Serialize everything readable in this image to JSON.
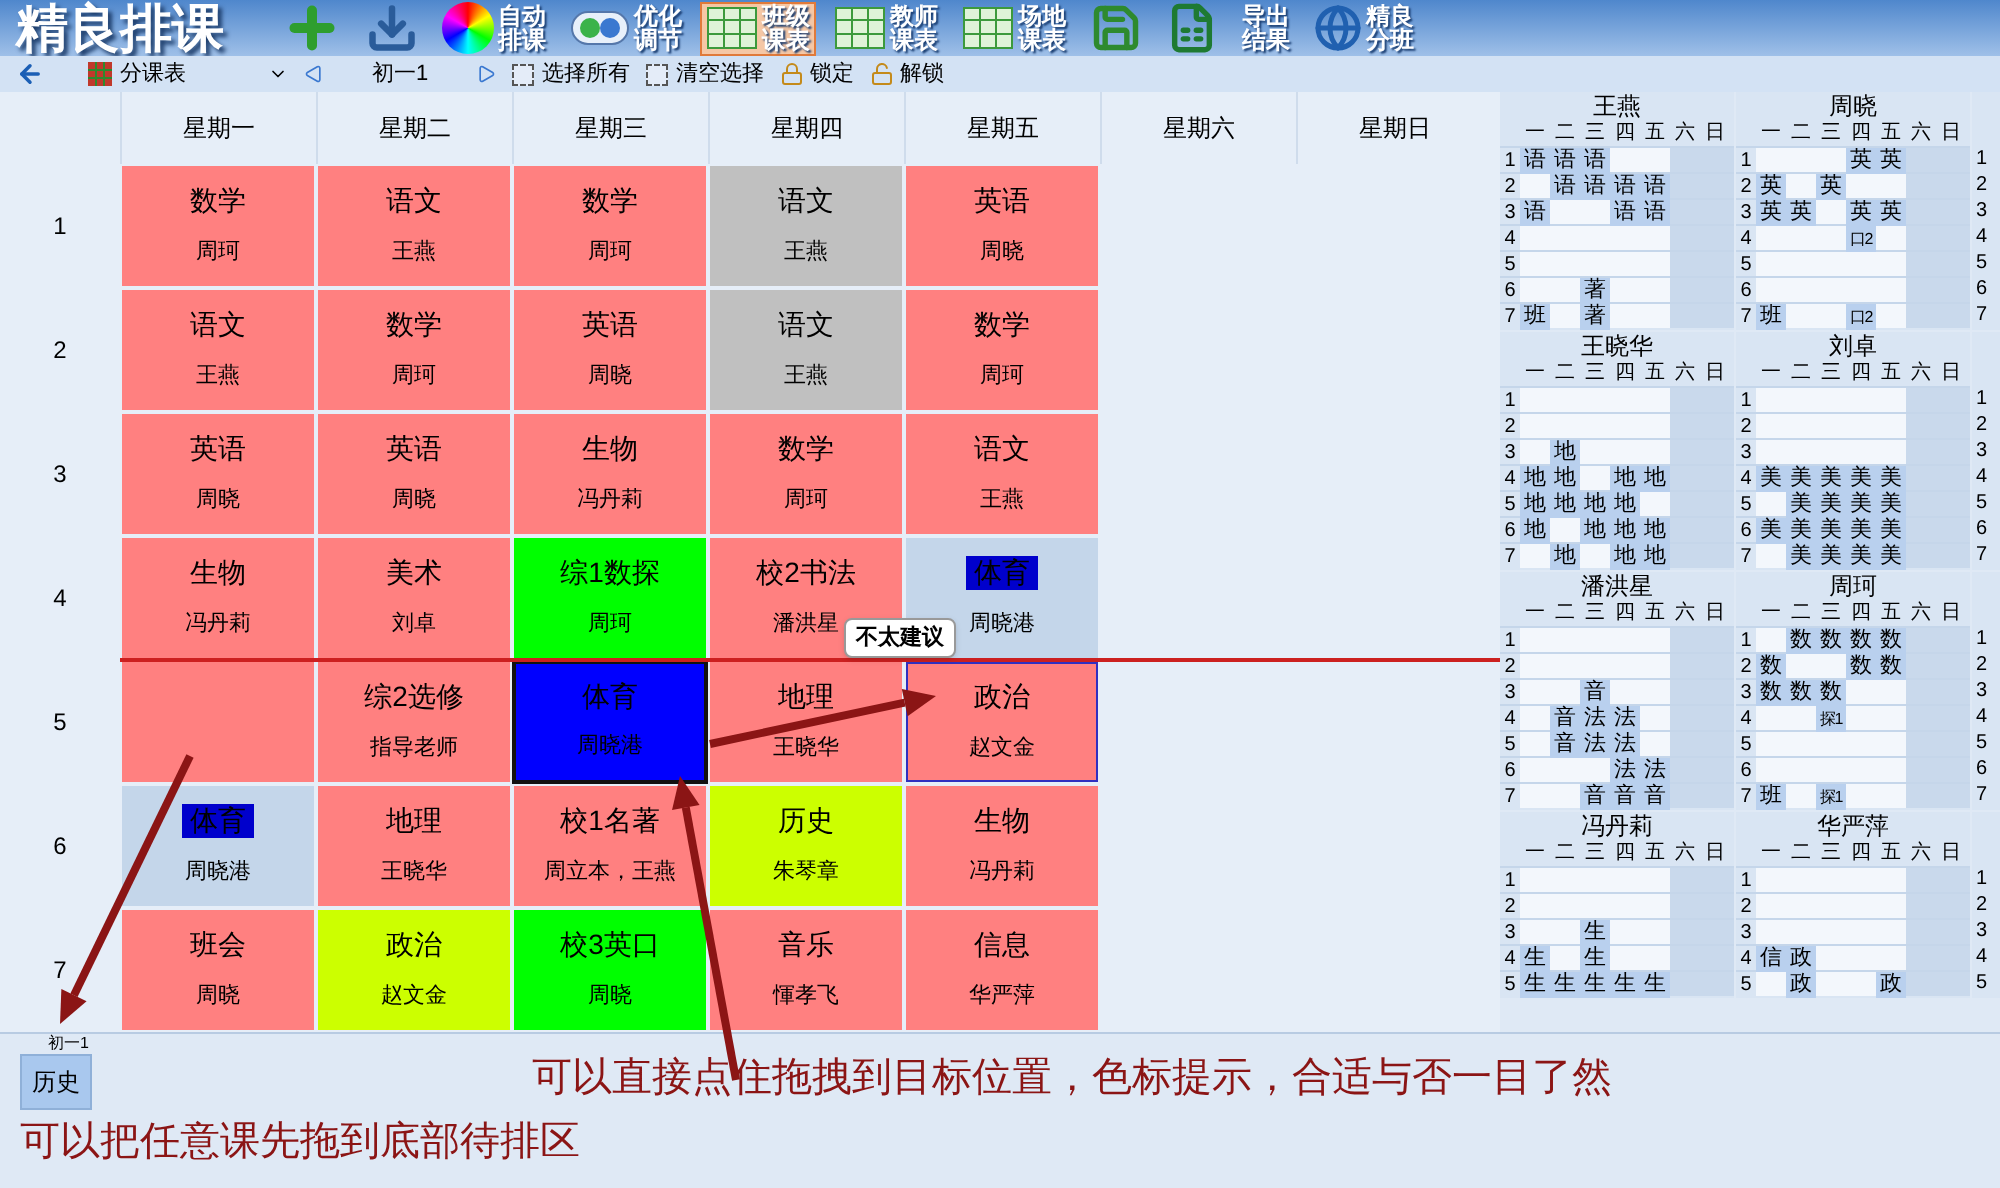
{
  "app_title": "精良排课",
  "toolbar": [
    {
      "kind": "add",
      "selected": false
    },
    {
      "kind": "import",
      "selected": false
    },
    {
      "kind": "auto",
      "lines": [
        "自动",
        "排课"
      ],
      "selected": false
    },
    {
      "kind": "optimize",
      "lines": [
        "优化",
        "调节"
      ],
      "selected": false
    },
    {
      "kind": "grid",
      "lines": [
        "班级",
        "课表"
      ],
      "selected": true
    },
    {
      "kind": "grid",
      "lines": [
        "教师",
        "课表"
      ],
      "selected": false
    },
    {
      "kind": "grid",
      "lines": [
        "场地",
        "课表"
      ],
      "selected": false
    },
    {
      "kind": "save",
      "selected": false
    },
    {
      "kind": "excel",
      "selected": false
    },
    {
      "kind": "text",
      "lines": [
        "导出",
        "结果"
      ],
      "selected": false
    },
    {
      "kind": "globe",
      "lines": [
        "精良",
        "分班"
      ],
      "selected": false
    }
  ],
  "nav": {
    "view": "分课表",
    "class_name": "初一1",
    "select_all": {
      "label": "选择所有",
      "checked": false
    },
    "clear_selection": {
      "label": "清空选择",
      "checked": false
    },
    "lock": "锁定",
    "unlock": "解锁"
  },
  "grid": {
    "columns": [
      "星期一",
      "星期二",
      "星期三",
      "星期四",
      "星期五",
      "星期六",
      "星期日"
    ],
    "rows": [
      {
        "period": "1",
        "cells": [
          {
            "subject": "数学",
            "teacher": "周珂",
            "color": "#ff8080",
            "selected": false,
            "drop_target": false,
            "highlighted": false
          },
          {
            "subject": "语文",
            "teacher": "王燕",
            "color": "#ff8080",
            "selected": false,
            "drop_target": false,
            "highlighted": false
          },
          {
            "subject": "数学",
            "teacher": "周珂",
            "color": "#ff8080",
            "selected": false,
            "drop_target": false,
            "highlighted": false
          },
          {
            "subject": "语文",
            "teacher": "王燕",
            "color": "#c0c0c0",
            "selected": false,
            "drop_target": false,
            "highlighted": false
          },
          {
            "subject": "英语",
            "teacher": "周晓",
            "color": "#ff8080",
            "selected": false,
            "drop_target": false,
            "highlighted": false
          }
        ]
      },
      {
        "period": "2",
        "cells": [
          {
            "subject": "语文",
            "teacher": "王燕",
            "color": "#ff8080",
            "selected": false,
            "drop_target": false,
            "highlighted": false
          },
          {
            "subject": "数学",
            "teacher": "周珂",
            "color": "#ff8080",
            "selected": false,
            "drop_target": false,
            "highlighted": false
          },
          {
            "subject": "英语",
            "teacher": "周晓",
            "color": "#ff8080",
            "selected": false,
            "drop_target": false,
            "highlighted": false
          },
          {
            "subject": "语文",
            "teacher": "王燕",
            "color": "#c0c0c0",
            "selected": false,
            "drop_target": false,
            "highlighted": false
          },
          {
            "subject": "数学",
            "teacher": "周珂",
            "color": "#ff8080",
            "selected": false,
            "drop_target": false,
            "highlighted": false
          }
        ]
      },
      {
        "period": "3",
        "cells": [
          {
            "subject": "英语",
            "teacher": "周晓",
            "color": "#ff8080",
            "selected": false,
            "drop_target": false,
            "highlighted": false
          },
          {
            "subject": "英语",
            "teacher": "周晓",
            "color": "#ff8080",
            "selected": false,
            "drop_target": false,
            "highlighted": false
          },
          {
            "subject": "生物",
            "teacher": "冯丹莉",
            "color": "#ff8080",
            "selected": false,
            "drop_target": false,
            "highlighted": false
          },
          {
            "subject": "数学",
            "teacher": "周珂",
            "color": "#ff8080",
            "selected": false,
            "drop_target": false,
            "highlighted": false
          },
          {
            "subject": "语文",
            "teacher": "王燕",
            "color": "#ff8080",
            "selected": false,
            "drop_target": false,
            "highlighted": false
          }
        ]
      },
      {
        "period": "4",
        "cells": [
          {
            "subject": "生物",
            "teacher": "冯丹莉",
            "color": "#ff8080",
            "selected": false,
            "drop_target": false,
            "highlighted": false
          },
          {
            "subject": "美术",
            "teacher": "刘卓",
            "color": "#ff8080",
            "selected": false,
            "drop_target": false,
            "highlighted": false
          },
          {
            "subject": "综1数探",
            "teacher": "周珂",
            "color": "#00ff00",
            "selected": false,
            "drop_target": false,
            "highlighted": false
          },
          {
            "subject": "校2书法",
            "teacher": "潘洪星",
            "color": "#ff8080",
            "selected": false,
            "drop_target": false,
            "highlighted": false
          },
          {
            "subject": "体育",
            "teacher": "周晓港",
            "color": "#c4d6ea",
            "selected": false,
            "drop_target": false,
            "highlighted": true
          }
        ]
      },
      {
        "period": "5",
        "cells": [
          {
            "color": "#ff8080",
            "selected": false,
            "drop_target": false
          },
          {
            "subject": "综2选修",
            "teacher": "指导老师",
            "color": "#ff8080",
            "selected": false,
            "drop_target": false,
            "highlighted": false
          },
          {
            "subject": "体育",
            "teacher": "周晓港",
            "color": "#0000ff",
            "selected": true,
            "drop_target": false,
            "highlighted": false
          },
          {
            "subject": "地理",
            "teacher": "王晓华",
            "color": "#ff8080",
            "selected": false,
            "drop_target": false,
            "highlighted": false
          },
          {
            "subject": "政治",
            "teacher": "赵文金",
            "color": "#ff8080",
            "selected": false,
            "drop_target": true,
            "highlighted": false
          }
        ]
      },
      {
        "period": "6",
        "cells": [
          {
            "subject": "体育",
            "teacher": "周晓港",
            "color": "#c4d6ea",
            "selected": false,
            "drop_target": false,
            "highlighted": true
          },
          {
            "subject": "地理",
            "teacher": "王晓华",
            "color": "#ff8080",
            "selected": false,
            "drop_target": false,
            "highlighted": false
          },
          {
            "subject": "校1名著",
            "teacher": "周立本，王燕",
            "color": "#ff8080",
            "selected": false,
            "drop_target": false,
            "highlighted": false
          },
          {
            "subject": "历史",
            "teacher": "朱琴章",
            "color": "#ccff00",
            "selected": false,
            "drop_target": false,
            "highlighted": false
          },
          {
            "subject": "生物",
            "teacher": "冯丹莉",
            "color": "#ff8080",
            "selected": false,
            "drop_target": false,
            "highlighted": false
          }
        ]
      },
      {
        "period": "7",
        "cells": [
          {
            "subject": "班会",
            "teacher": "周晓",
            "color": "#ff8080",
            "selected": false,
            "drop_target": false,
            "highlighted": false
          },
          {
            "subject": "政治",
            "teacher": "赵文金",
            "color": "#ccff00",
            "selected": false,
            "drop_target": false,
            "highlighted": false
          },
          {
            "subject": "校3英口",
            "teacher": "周晓",
            "color": "#00ff00",
            "selected": false,
            "drop_target": false,
            "highlighted": false
          },
          {
            "subject": "音乐",
            "teacher": "惲孝飞",
            "color": "#ff8080",
            "selected": false,
            "drop_target": false,
            "highlighted": false
          },
          {
            "subject": "信息",
            "teacher": "华严萍",
            "color": "#ff8080",
            "selected": false,
            "drop_target": false,
            "highlighted": false
          }
        ]
      }
    ],
    "tooltip": "不太建议"
  },
  "teacher_tables": [
    {
      "name": "王燕",
      "columns": [
        "一",
        "二",
        "三",
        "四",
        "五",
        "六",
        "日"
      ],
      "rows": [
        {
          "label": "1",
          "cells": [
            "语",
            "语",
            "语",
            null,
            null,
            null,
            null
          ]
        },
        {
          "label": "2",
          "cells": [
            null,
            "语",
            "语",
            "语",
            "语",
            null,
            null
          ]
        },
        {
          "label": "3",
          "cells": [
            "语",
            null,
            null,
            "语",
            "语",
            null,
            null
          ]
        },
        {
          "label": "4",
          "cells": [
            null,
            null,
            null,
            null,
            null,
            null,
            null
          ]
        },
        {
          "label": "5",
          "cells": [
            null,
            null,
            null,
            null,
            null,
            null,
            null
          ]
        },
        {
          "label": "6",
          "cells": [
            null,
            null,
            "著",
            null,
            null,
            null,
            null
          ]
        },
        {
          "label": "7",
          "cells": [
            "班",
            null,
            "著",
            null,
            null,
            null,
            null
          ]
        }
      ]
    },
    {
      "name": "周晓",
      "columns": [
        "一",
        "二",
        "三",
        "四",
        "五",
        "六",
        "日"
      ],
      "rows": [
        {
          "label": "1",
          "cells": [
            null,
            null,
            null,
            "英",
            "英",
            null,
            null
          ]
        },
        {
          "label": "2",
          "cells": [
            "英",
            null,
            "英",
            null,
            null,
            null,
            null
          ]
        },
        {
          "label": "3",
          "cells": [
            "英",
            "英",
            null,
            "英",
            "英",
            null,
            null
          ]
        },
        {
          "label": "4",
          "cells": [
            null,
            null,
            null,
            "口2",
            null,
            null,
            null
          ]
        },
        {
          "label": "5",
          "cells": [
            null,
            null,
            null,
            null,
            null,
            null,
            null
          ]
        },
        {
          "label": "6",
          "cells": [
            null,
            null,
            null,
            null,
            null,
            null,
            null
          ]
        },
        {
          "label": "7",
          "cells": [
            "班",
            null,
            null,
            "口2",
            null,
            null,
            null
          ]
        }
      ]
    },
    {
      "name": "王晓华",
      "columns": [
        "一",
        "二",
        "三",
        "四",
        "五",
        "六",
        "日"
      ],
      "rows": [
        {
          "label": "1",
          "cells": [
            null,
            null,
            null,
            null,
            null,
            null,
            null
          ]
        },
        {
          "label": "2",
          "cells": [
            null,
            null,
            null,
            null,
            null,
            null,
            null
          ]
        },
        {
          "label": "3",
          "cells": [
            null,
            "地",
            null,
            null,
            null,
            null,
            null
          ]
        },
        {
          "label": "4",
          "cells": [
            "地",
            "地",
            null,
            "地",
            "地",
            null,
            null
          ]
        },
        {
          "label": "5",
          "cells": [
            "地",
            "地",
            "地",
            "地",
            null,
            null,
            null
          ]
        },
        {
          "label": "6",
          "cells": [
            "地",
            null,
            "地",
            "地",
            "地",
            null,
            null
          ]
        },
        {
          "label": "7",
          "cells": [
            null,
            "地",
            null,
            "地",
            "地",
            null,
            null
          ]
        }
      ]
    },
    {
      "name": "刘卓",
      "columns": [
        "一",
        "二",
        "三",
        "四",
        "五",
        "六",
        "日"
      ],
      "rows": [
        {
          "label": "1",
          "cells": [
            null,
            null,
            null,
            null,
            null,
            null,
            null
          ]
        },
        {
          "label": "2",
          "cells": [
            null,
            null,
            null,
            null,
            null,
            null,
            null
          ]
        },
        {
          "label": "3",
          "cells": [
            null,
            null,
            null,
            null,
            null,
            null,
            null
          ]
        },
        {
          "label": "4",
          "cells": [
            "美",
            "美",
            "美",
            "美",
            "美",
            null,
            null
          ]
        },
        {
          "label": "5",
          "cells": [
            null,
            "美",
            "美",
            "美",
            "美",
            null,
            null
          ]
        },
        {
          "label": "6",
          "cells": [
            "美",
            "美",
            "美",
            "美",
            "美",
            null,
            null
          ]
        },
        {
          "label": "7",
          "cells": [
            null,
            "美",
            "美",
            "美",
            "美",
            null,
            null
          ]
        }
      ]
    },
    {
      "name": "潘洪星",
      "columns": [
        "一",
        "二",
        "三",
        "四",
        "五",
        "六",
        "日"
      ],
      "rows": [
        {
          "label": "1",
          "cells": [
            null,
            null,
            null,
            null,
            null,
            null,
            null
          ]
        },
        {
          "label": "2",
          "cells": [
            null,
            null,
            null,
            null,
            null,
            null,
            null
          ]
        },
        {
          "label": "3",
          "cells": [
            null,
            null,
            "音",
            null,
            null,
            null,
            null
          ]
        },
        {
          "label": "4",
          "cells": [
            null,
            "音",
            "法",
            "法",
            null,
            null,
            null
          ]
        },
        {
          "label": "5",
          "cells": [
            null,
            "音",
            "法",
            "法",
            null,
            null,
            null
          ]
        },
        {
          "label": "6",
          "cells": [
            null,
            null,
            null,
            "法",
            "法",
            null,
            null
          ]
        },
        {
          "label": "7",
          "cells": [
            null,
            null,
            "音",
            "音",
            "音",
            null,
            null
          ]
        }
      ]
    },
    {
      "name": "周珂",
      "columns": [
        "一",
        "二",
        "三",
        "四",
        "五",
        "六",
        "日"
      ],
      "rows": [
        {
          "label": "1",
          "cells": [
            null,
            "数",
            "数",
            "数",
            "数",
            null,
            null
          ]
        },
        {
          "label": "2",
          "cells": [
            "数",
            null,
            null,
            "数",
            "数",
            null,
            null
          ]
        },
        {
          "label": "3",
          "cells": [
            "数",
            "数",
            "数",
            null,
            null,
            null,
            null
          ]
        },
        {
          "label": "4",
          "cells": [
            null,
            null,
            "探1",
            null,
            null,
            null,
            null
          ]
        },
        {
          "label": "5",
          "cells": [
            null,
            null,
            null,
            null,
            null,
            null,
            null
          ]
        },
        {
          "label": "6",
          "cells": [
            null,
            null,
            null,
            null,
            null,
            null,
            null
          ]
        },
        {
          "label": "7",
          "cells": [
            "班",
            null,
            "探1",
            null,
            null,
            null,
            null
          ]
        }
      ]
    },
    {
      "name": "冯丹莉",
      "columns": [
        "一",
        "二",
        "三",
        "四",
        "五",
        "六",
        "日"
      ],
      "rows": [
        {
          "label": "1",
          "cells": [
            null,
            null,
            null,
            null,
            null,
            null,
            null
          ]
        },
        {
          "label": "2",
          "cells": [
            null,
            null,
            null,
            null,
            null,
            null,
            null
          ]
        },
        {
          "label": "3",
          "cells": [
            null,
            null,
            "生",
            null,
            null,
            null,
            null
          ]
        },
        {
          "label": "4",
          "cells": [
            "生",
            null,
            "生",
            null,
            null,
            null,
            null
          ]
        },
        {
          "label": "5",
          "cells": [
            "生",
            "生",
            "生",
            "生",
            "生",
            null,
            null
          ]
        }
      ]
    },
    {
      "name": "华严萍",
      "columns": [
        "一",
        "二",
        "三",
        "四",
        "五",
        "六",
        "日"
      ],
      "rows": [
        {
          "label": "1",
          "cells": [
            null,
            null,
            null,
            null,
            null,
            null,
            null
          ]
        },
        {
          "label": "2",
          "cells": [
            null,
            null,
            null,
            null,
            null,
            null,
            null
          ]
        },
        {
          "label": "3",
          "cells": [
            null,
            null,
            null,
            null,
            null,
            null,
            null
          ]
        },
        {
          "label": "4",
          "cells": [
            "信",
            "政",
            null,
            null,
            null,
            null,
            null
          ]
        },
        {
          "label": "5",
          "cells": [
            null,
            "政",
            null,
            null,
            "政",
            null,
            null
          ]
        }
      ]
    }
  ],
  "cut_tables": [
    {
      "row_labels": [
        "1",
        "2",
        "3",
        "4",
        "5",
        "6",
        "7"
      ]
    },
    {
      "row_labels": [
        "1",
        "2",
        "3",
        "4",
        "5",
        "6",
        "7"
      ]
    },
    {
      "row_labels": [
        "1",
        "2",
        "3",
        "4",
        "5",
        "6",
        "7"
      ]
    },
    {
      "row_labels": [
        "1",
        "2",
        "3",
        "4",
        "5"
      ]
    }
  ],
  "pending": {
    "class_name": "初一1",
    "items": [
      {
        "subject": "历史"
      }
    ]
  },
  "annotations": [
    "可以直接点住拖拽到目标位置，色标提示，合适与否一目了然",
    "可以把任意课先拖到底部待排区"
  ]
}
